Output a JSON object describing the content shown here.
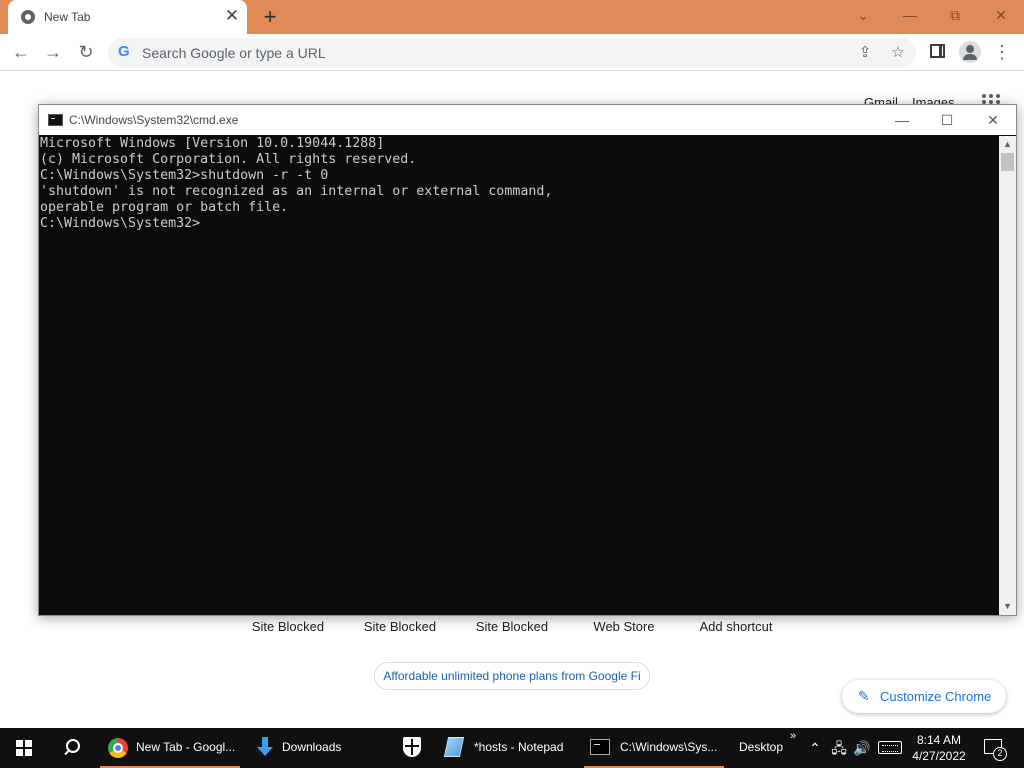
{
  "browser": {
    "tab_title": "New Tab",
    "tab_close": "✕",
    "new_tab": "+",
    "controls": {
      "tab_search": "⌄",
      "minimize": "—",
      "restore": "⧉",
      "close": "✕"
    },
    "omnibox": {
      "logo": "G",
      "placeholder": "Search Google or type a URL"
    },
    "nav": {
      "back": "←",
      "forward": "→",
      "reload": "↻"
    },
    "icons": {
      "share": "⇪",
      "bookmark": "☆",
      "menu": "⋮"
    }
  },
  "ntp": {
    "gmail": "Gmail",
    "images": "Images",
    "shortcuts": [
      "Site Blocked",
      "Site Blocked",
      "Site Blocked",
      "Web Store",
      "Add shortcut"
    ],
    "promo": "Affordable unlimited phone plans from Google Fi",
    "customize_icon": "✎",
    "customize": "Customize Chrome"
  },
  "cmd": {
    "title": "C:\\Windows\\System32\\cmd.exe",
    "controls": {
      "minimize": "—",
      "maximize": "☐",
      "close": "✕"
    },
    "lines": [
      "Microsoft Windows [Version 10.0.19044.1288]",
      "(c) Microsoft Corporation. All rights reserved.",
      "",
      "C:\\Windows\\System32>shutdown -r -t 0",
      "'shutdown' is not recognized as an internal or external command,",
      "operable program or batch file.",
      "",
      "C:\\Windows\\System32>"
    ],
    "scroll_up": "▲",
    "scroll_down": "▼"
  },
  "taskbar": {
    "items": [
      {
        "label": "New Tab - Googl..."
      },
      {
        "label": "Downloads"
      },
      {
        "label": "*hosts - Notepad"
      },
      {
        "label": "C:\\Windows\\Sys..."
      }
    ],
    "desktop": "Desktop",
    "overflow": "»",
    "tray_up": "⌃",
    "network": "🖧",
    "volume": "🔊",
    "time": "8:14 AM",
    "date": "4/27/2022",
    "notifications": "2"
  },
  "colors": {
    "tabstrip": "#e08a58",
    "cmd_background": "#0c0c0c",
    "cmd_text": "#cccccc",
    "taskbar": "#101010",
    "link_blue": "#1a73e8"
  }
}
